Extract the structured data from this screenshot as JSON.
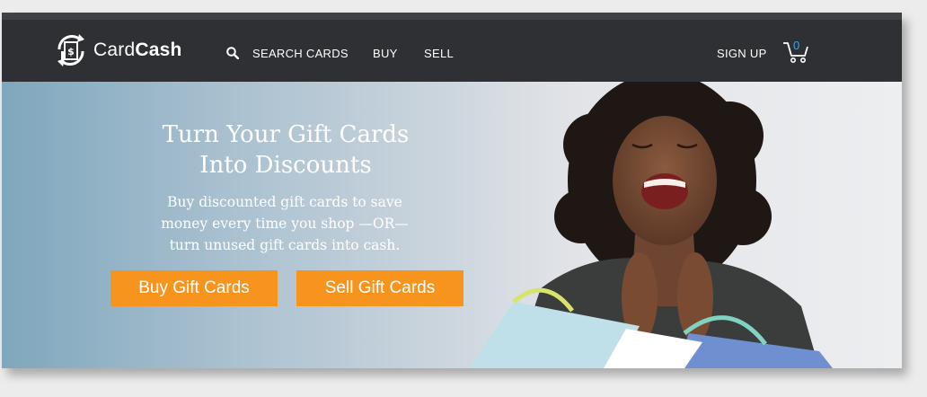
{
  "brand": {
    "name_light": "Card",
    "name_bold": "Cash"
  },
  "nav": {
    "search": "SEARCH CARDS",
    "buy": "BUY",
    "sell": "SELL",
    "signup": "SIGN UP",
    "cart_count": "0"
  },
  "hero": {
    "title_line1": "Turn Your Gift Cards",
    "title_line2": "Into Discounts",
    "sub_line1": "Buy discounted gift cards to save",
    "sub_line2": "money every time you shop —OR—",
    "sub_line3": "turn unused gift cards into cash.",
    "buy_button": "Buy Gift Cards",
    "sell_button": "Sell Gift Cards"
  },
  "colors": {
    "topbar": "#2e3033",
    "accent_orange": "#f7941d",
    "cart_count_blue": "#3da5e8"
  },
  "icons": {
    "logo": "cardcash-logo-icon",
    "search": "search-icon",
    "cart": "cart-icon"
  }
}
